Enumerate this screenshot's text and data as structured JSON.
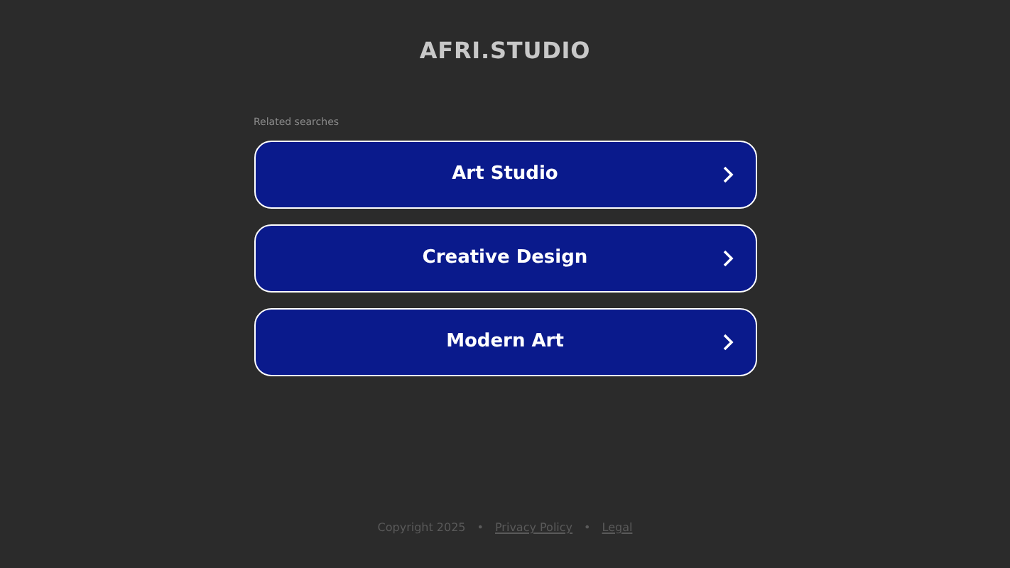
{
  "site_title": "AFRI.STUDIO",
  "related_label": "Related searches",
  "searches": [
    {
      "label": "Art Studio"
    },
    {
      "label": "Creative Design"
    },
    {
      "label": "Modern Art"
    }
  ],
  "footer": {
    "copyright": "Copyright 2025",
    "separator": "•",
    "links": [
      "Privacy Policy",
      "Legal"
    ]
  }
}
